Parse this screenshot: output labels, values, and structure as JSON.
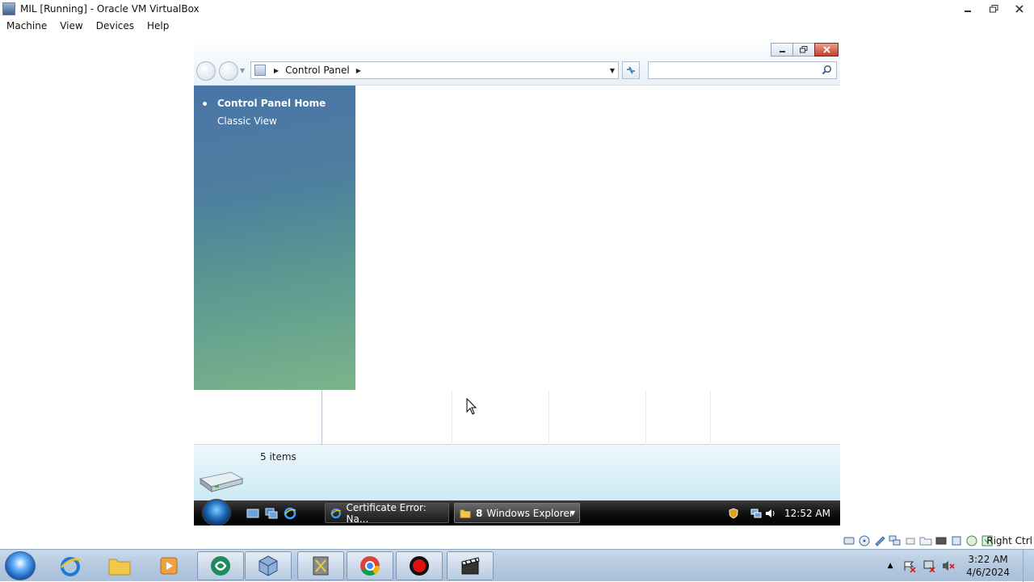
{
  "host_window": {
    "title": "MIL [Running] - Oracle VM VirtualBox",
    "menu": [
      "Machine",
      "View",
      "Devices",
      "Help"
    ],
    "host_key_label": "Right Ctrl"
  },
  "explorer": {
    "address_path": "Control Panel",
    "search_placeholder": "",
    "sidebar": {
      "home_label": "Control Panel Home",
      "classic_label": "Classic View"
    },
    "details_text": "5 items"
  },
  "guest_taskbar": {
    "tasks": [
      {
        "label": "Certificate Error: Na...",
        "icon": "ie-icon"
      },
      {
        "count": "8",
        "label": "Windows Explorer",
        "icon": "folder-icon"
      }
    ],
    "clock": "12:52 AM"
  },
  "host_taskbar": {
    "clock_time": "3:22 AM",
    "clock_date": "4/6/2024"
  },
  "colors": {
    "sidebar_top": "#4a74a8",
    "sidebar_bottom": "#7bb48a",
    "accent": "#2a6bb8"
  }
}
